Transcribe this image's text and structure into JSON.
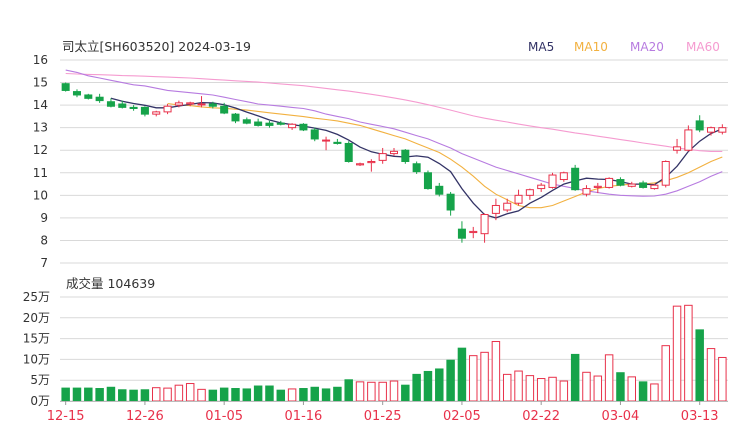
{
  "header": {
    "title": "司太立[SH603520] 2024-03-19",
    "volume_label": "成交量 104639"
  },
  "colors": {
    "up": "#e8314a",
    "down": "#16a34a",
    "grid": "#d9d9d9",
    "axis_text": "#333333",
    "date_text": "#e8314a",
    "ma5": "#333366",
    "ma10": "#f2b140",
    "ma20": "#b77be0",
    "ma60": "#f59bd0"
  },
  "chart_data": [
    {
      "type": "candlestick",
      "title": "司太立[SH603520] 2024-03-19",
      "ylim": [
        7,
        16
      ],
      "y_ticks": [
        "7",
        "8",
        "9",
        "10",
        "11",
        "12",
        "13",
        "14",
        "15",
        "16"
      ],
      "grid": true,
      "legend": [
        {
          "key": "ma5",
          "label": "MA5"
        },
        {
          "key": "ma10",
          "label": "MA10"
        },
        {
          "key": "ma20",
          "label": "MA20"
        },
        {
          "key": "ma60",
          "label": "MA60"
        }
      ],
      "legend_position": "top-right",
      "x_labels": [
        {
          "index": 0,
          "label": "12-15"
        },
        {
          "index": 7,
          "label": "12-26"
        },
        {
          "index": 14,
          "label": "01-05"
        },
        {
          "index": 21,
          "label": "01-16"
        },
        {
          "index": 28,
          "label": "01-25"
        },
        {
          "index": 35,
          "label": "02-05"
        },
        {
          "index": 42,
          "label": "02-22"
        },
        {
          "index": 49,
          "label": "03-04"
        },
        {
          "index": 56,
          "label": "03-13"
        }
      ],
      "ohlc": [
        [
          14.95,
          15.0,
          14.6,
          14.65
        ],
        [
          14.6,
          14.7,
          14.35,
          14.45
        ],
        [
          14.45,
          14.5,
          14.25,
          14.3
        ],
        [
          14.35,
          14.5,
          14.1,
          14.2
        ],
        [
          14.15,
          14.3,
          13.9,
          13.95
        ],
        [
          14.05,
          14.2,
          13.85,
          13.9
        ],
        [
          13.9,
          14.0,
          13.75,
          13.85
        ],
        [
          13.9,
          13.95,
          13.5,
          13.6
        ],
        [
          13.6,
          13.75,
          13.5,
          13.7
        ],
        [
          13.7,
          14.05,
          13.6,
          13.95
        ],
        [
          14.0,
          14.2,
          13.9,
          14.1
        ],
        [
          14.05,
          14.15,
          13.95,
          14.1
        ],
        [
          14.05,
          14.4,
          13.9,
          14.05
        ],
        [
          14.05,
          14.15,
          13.85,
          13.95
        ],
        [
          13.95,
          14.1,
          13.6,
          13.65
        ],
        [
          13.6,
          13.65,
          13.2,
          13.3
        ],
        [
          13.35,
          13.45,
          13.15,
          13.2
        ],
        [
          13.25,
          13.4,
          13.05,
          13.1
        ],
        [
          13.2,
          13.3,
          13.0,
          13.1
        ],
        [
          13.2,
          13.3,
          13.1,
          13.15
        ],
        [
          13.0,
          13.2,
          12.9,
          13.15
        ],
        [
          13.15,
          13.2,
          12.85,
          12.9
        ],
        [
          12.9,
          13.0,
          12.4,
          12.5
        ],
        [
          12.45,
          12.6,
          12.0,
          12.45
        ],
        [
          12.35,
          12.5,
          12.25,
          12.3
        ],
        [
          12.3,
          12.4,
          11.45,
          11.5
        ],
        [
          11.35,
          11.45,
          11.3,
          11.4
        ],
        [
          11.45,
          11.6,
          11.05,
          11.5
        ],
        [
          11.55,
          12.1,
          11.4,
          11.85
        ],
        [
          11.85,
          12.1,
          11.75,
          11.95
        ],
        [
          12.0,
          12.05,
          11.4,
          11.5
        ],
        [
          11.4,
          11.5,
          10.95,
          11.05
        ],
        [
          11.0,
          11.1,
          10.25,
          10.3
        ],
        [
          10.4,
          10.55,
          9.95,
          10.05
        ],
        [
          10.05,
          10.15,
          9.1,
          9.35
        ],
        [
          8.5,
          8.85,
          7.9,
          8.1
        ],
        [
          8.35,
          8.6,
          8.1,
          8.4
        ],
        [
          8.3,
          9.2,
          7.9,
          9.15
        ],
        [
          9.2,
          9.85,
          8.9,
          9.55
        ],
        [
          9.35,
          9.85,
          9.25,
          9.65
        ],
        [
          9.65,
          10.25,
          9.55,
          10.0
        ],
        [
          10.0,
          10.3,
          9.8,
          10.25
        ],
        [
          10.3,
          10.55,
          10.15,
          10.45
        ],
        [
          10.35,
          11.0,
          10.3,
          10.9
        ],
        [
          10.7,
          11.05,
          10.6,
          11.0
        ],
        [
          11.2,
          11.35,
          10.2,
          10.25
        ],
        [
          10.05,
          10.45,
          9.95,
          10.3
        ],
        [
          10.35,
          10.55,
          10.1,
          10.4
        ],
        [
          10.35,
          10.8,
          10.3,
          10.75
        ],
        [
          10.7,
          10.8,
          10.4,
          10.45
        ],
        [
          10.4,
          10.6,
          10.35,
          10.5
        ],
        [
          10.55,
          10.65,
          10.3,
          10.35
        ],
        [
          10.3,
          10.5,
          10.25,
          10.45
        ],
        [
          10.45,
          11.55,
          10.35,
          11.5
        ],
        [
          12.0,
          12.5,
          11.85,
          12.15
        ],
        [
          12.0,
          13.1,
          11.95,
          12.9
        ],
        [
          13.3,
          13.55,
          12.8,
          12.9
        ],
        [
          12.8,
          13.05,
          12.65,
          13.0
        ],
        [
          12.8,
          13.15,
          12.7,
          13.0
        ]
      ],
      "ma": {
        "ma5": [
          null,
          null,
          null,
          null,
          14.3,
          14.17,
          14.07,
          13.99,
          13.88,
          13.88,
          13.96,
          14.03,
          14.11,
          14.1,
          14.02,
          13.87,
          13.69,
          13.52,
          13.34,
          13.21,
          13.13,
          13.07,
          12.98,
          12.88,
          12.7,
          12.45,
          12.14,
          11.93,
          11.82,
          11.73,
          11.7,
          11.75,
          11.69,
          11.41,
          11.05,
          10.3,
          9.65,
          9.14,
          9.0,
          9.18,
          9.31,
          9.65,
          9.91,
          10.22,
          10.5,
          10.64,
          10.76,
          10.72,
          10.7,
          10.61,
          10.5,
          10.5,
          10.47,
          10.8,
          11.29,
          11.95,
          12.4,
          12.74,
          12.95
        ],
        "ma10": [
          null,
          null,
          null,
          null,
          null,
          null,
          null,
          null,
          null,
          14.07,
          14.0,
          13.98,
          13.92,
          13.88,
          13.86,
          13.82,
          13.78,
          13.72,
          13.66,
          13.6,
          13.55,
          13.49,
          13.42,
          13.36,
          13.3,
          13.2,
          13.1,
          12.95,
          12.8,
          12.65,
          12.5,
          12.3,
          12.1,
          11.9,
          11.6,
          11.25,
          10.85,
          10.4,
          10.05,
          9.8,
          9.55,
          9.45,
          9.45,
          9.55,
          9.75,
          9.95,
          10.15,
          10.3,
          10.4,
          10.45,
          10.5,
          10.5,
          10.55,
          10.65,
          10.8,
          11.0,
          11.25,
          11.5,
          11.7
        ],
        "ma20": [
          15.55,
          15.45,
          15.3,
          15.2,
          15.1,
          15.0,
          14.9,
          14.85,
          14.75,
          14.65,
          14.6,
          14.55,
          14.5,
          14.45,
          14.35,
          14.25,
          14.15,
          14.05,
          14.0,
          13.95,
          13.9,
          13.85,
          13.75,
          13.6,
          13.5,
          13.4,
          13.25,
          13.15,
          13.05,
          12.95,
          12.8,
          12.65,
          12.5,
          12.3,
          12.1,
          11.85,
          11.65,
          11.45,
          11.25,
          11.1,
          10.95,
          10.8,
          10.65,
          10.5,
          10.4,
          10.3,
          10.2,
          10.12,
          10.05,
          10.0,
          9.98,
          9.96,
          9.97,
          10.05,
          10.2,
          10.4,
          10.6,
          10.85,
          11.05
        ],
        "ma60": [
          15.4,
          15.38,
          15.36,
          15.35,
          15.33,
          15.31,
          15.3,
          15.28,
          15.26,
          15.24,
          15.22,
          15.2,
          15.17,
          15.14,
          15.11,
          15.08,
          15.05,
          15.02,
          14.98,
          14.94,
          14.9,
          14.86,
          14.8,
          14.74,
          14.68,
          14.62,
          14.55,
          14.48,
          14.4,
          14.32,
          14.23,
          14.13,
          14.02,
          13.9,
          13.78,
          13.65,
          13.52,
          13.42,
          13.33,
          13.25,
          13.16,
          13.08,
          13.0,
          12.93,
          12.85,
          12.77,
          12.7,
          12.62,
          12.55,
          12.47,
          12.4,
          12.32,
          12.25,
          12.18,
          12.1,
          12.04,
          11.98,
          11.95,
          11.95
        ]
      }
    },
    {
      "type": "bar",
      "title": "成交量 104639",
      "ylim": [
        0,
        250000
      ],
      "y_ticks": [
        "0万",
        "5万",
        "10万",
        "15万",
        "20万",
        "25万"
      ],
      "values": [
        31000,
        31000,
        31000,
        30000,
        33000,
        27000,
        26000,
        27000,
        32000,
        31000,
        38000,
        42000,
        28000,
        26000,
        31000,
        30000,
        29000,
        36000,
        36000,
        26000,
        29000,
        30000,
        33000,
        29000,
        33000,
        51000,
        46000,
        45000,
        45000,
        48000,
        38000,
        64000,
        71000,
        77000,
        98000,
        127000,
        109000,
        117000,
        143000,
        64000,
        72000,
        61000,
        54000,
        57000,
        48000,
        112000,
        69000,
        60000,
        111000,
        68000,
        58000,
        46000,
        41000,
        133000,
        228000,
        230000,
        171000,
        126000,
        104639
      ],
      "up": [
        false,
        false,
        false,
        false,
        false,
        false,
        false,
        false,
        true,
        true,
        true,
        true,
        true,
        false,
        false,
        false,
        false,
        false,
        false,
        false,
        true,
        false,
        false,
        false,
        false,
        false,
        true,
        true,
        true,
        true,
        false,
        false,
        false,
        false,
        false,
        false,
        true,
        true,
        true,
        true,
        true,
        true,
        true,
        true,
        true,
        false,
        true,
        true,
        true,
        false,
        true,
        false,
        true,
        true,
        true,
        true,
        false,
        true,
        true
      ]
    }
  ]
}
